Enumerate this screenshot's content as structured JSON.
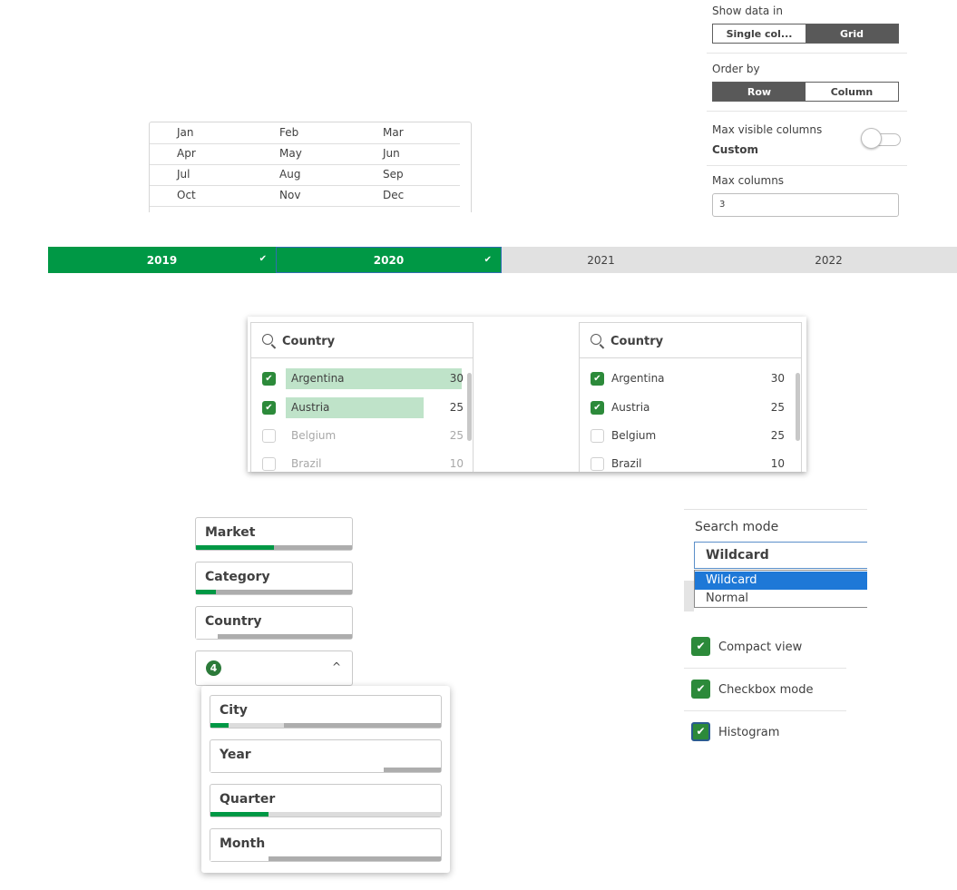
{
  "properties": {
    "show_data_in": {
      "label": "Show data in",
      "options": [
        "Single col...",
        "Grid"
      ],
      "selected": "Grid"
    },
    "order_by": {
      "label": "Order by",
      "options": [
        "Row",
        "Column"
      ],
      "selected": "Row"
    },
    "max_visible_columns": {
      "label": "Max visible columns",
      "value": "Custom"
    },
    "max_columns": {
      "label": "Max columns",
      "value": "3"
    }
  },
  "month_grid": {
    "rows": [
      [
        "Jan",
        "Feb",
        "Mar"
      ],
      [
        "Apr",
        "May",
        "Jun"
      ],
      [
        "Jul",
        "Aug",
        "Sep"
      ],
      [
        "Oct",
        "Nov",
        "Dec"
      ]
    ]
  },
  "year_bar": {
    "years": [
      {
        "label": "2019",
        "selected": true
      },
      {
        "label": "2020",
        "selected": true
      },
      {
        "label": "2021",
        "selected": false
      },
      {
        "label": "2022",
        "selected": false
      }
    ],
    "check": "✔"
  },
  "country_boxes": {
    "title": "Country",
    "items": [
      {
        "name": "Argentina",
        "count": "30",
        "selected": true,
        "histogram": 1.0
      },
      {
        "name": "Austria",
        "count": "25",
        "selected": true,
        "histogram": 0.8
      },
      {
        "name": "Belgium",
        "count": "25",
        "selected": false
      },
      {
        "name": "Brazil",
        "count": "10",
        "selected": false
      }
    ]
  },
  "fields": {
    "chips": [
      {
        "label": "Market",
        "green": 0.5,
        "white": 0
      },
      {
        "label": "Category",
        "green": 0.13,
        "white": 0
      },
      {
        "label": "Country",
        "green": 0,
        "white": 0.14
      }
    ],
    "more_badge": "4",
    "caret": "^",
    "popover_chips": [
      {
        "label": "City",
        "green": 0.08,
        "light": 0.32,
        "white": 0
      },
      {
        "label": "Year",
        "green": 0,
        "light": 0,
        "white": 0.75
      },
      {
        "label": "Quarter",
        "green": 0.25,
        "light": 0,
        "white": 0
      },
      {
        "label": "Month",
        "green": 0,
        "light": 0,
        "white": 0.25
      }
    ]
  },
  "search_mode": {
    "label": "Search mode",
    "value": "Wildcard",
    "options": [
      "Wildcard",
      "Normal"
    ]
  },
  "options": [
    {
      "label": "Compact view",
      "checked": true
    },
    {
      "label": "Checkbox mode",
      "checked": true
    },
    {
      "label": "Histogram",
      "checked": true
    }
  ],
  "colors": {
    "green": "#009845",
    "selection_histogram": "#bfe3c9",
    "dropdown_highlight": "#1e78d7"
  }
}
